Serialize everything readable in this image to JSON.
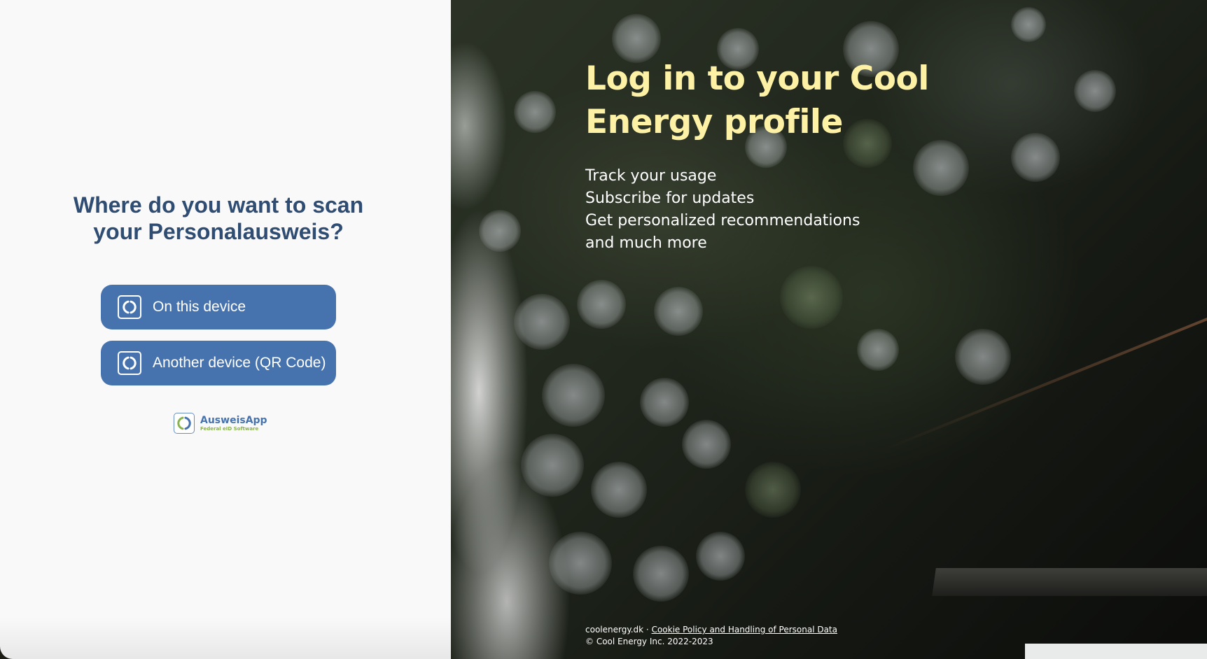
{
  "left": {
    "title_line1": "Where do you want to scan",
    "title_line2": "your Personalausweis?",
    "buttons": [
      {
        "label": "On this device",
        "icon": "ausweisapp-icon"
      },
      {
        "label": "Another device (QR Code)",
        "icon": "ausweisapp-icon"
      }
    ],
    "logo": {
      "name": "AusweisApp",
      "subtitle": "Federal eID Software"
    }
  },
  "right": {
    "title": "Log in to your Cool Energy profile",
    "features": [
      "Track your usage",
      "Subscribe for updates",
      "Get personalized recommendations",
      "and much more"
    ],
    "footer": {
      "domain": "coolenergy.dk",
      "separator": " · ",
      "policy_link": "Cookie Policy and Handling of Personal Data",
      "copyright": "© Cool Energy Inc. 2022-2023"
    }
  },
  "colors": {
    "button_bg": "#4673ae",
    "title_blue": "#2f4d73",
    "hero_title": "#fdf1a5",
    "logo_green": "#8ab34f"
  }
}
